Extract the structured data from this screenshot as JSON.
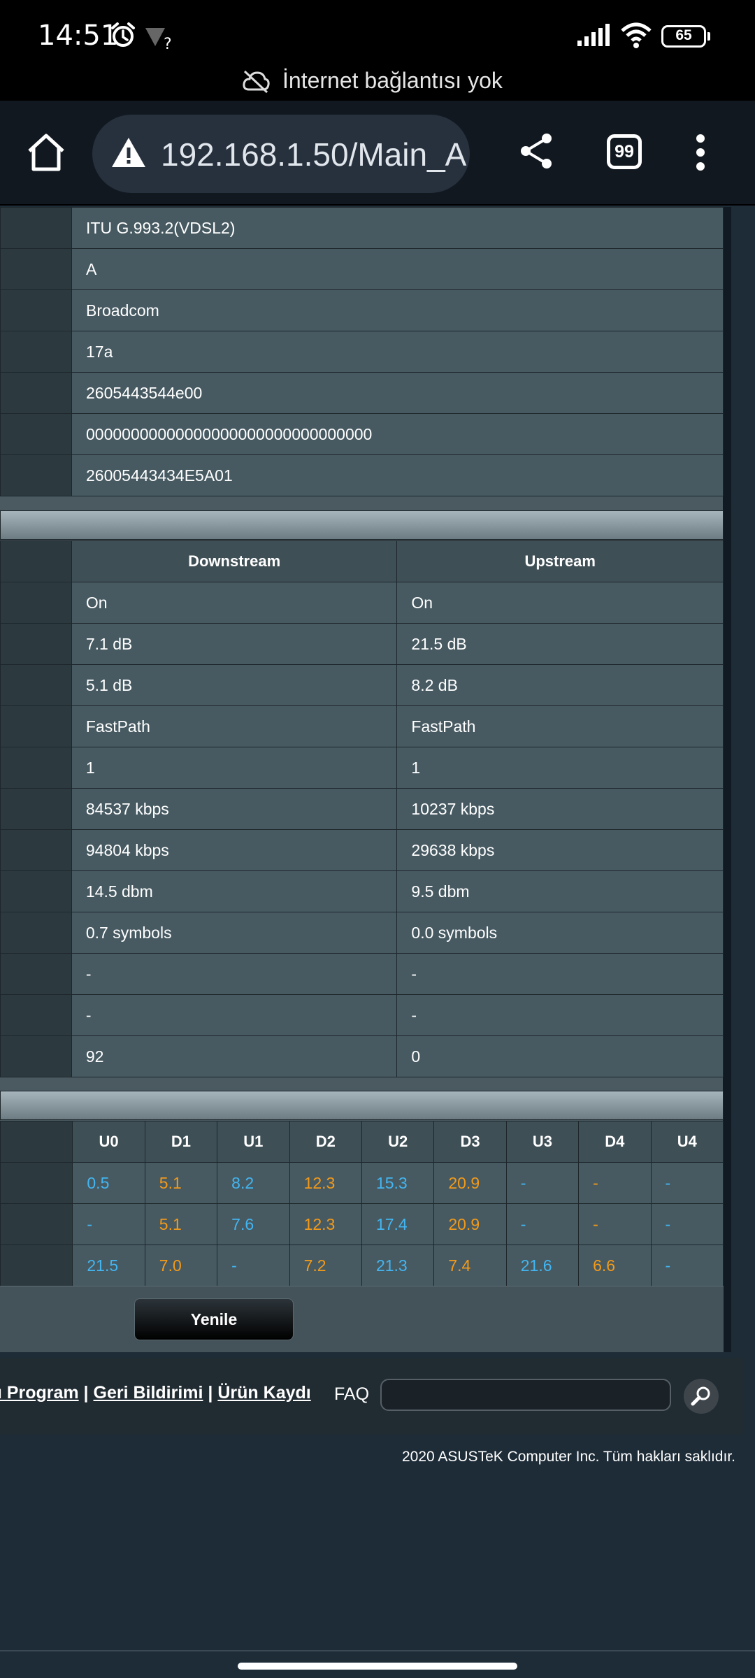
{
  "status_bar": {
    "time": "14:51",
    "battery": "65"
  },
  "offline_banner": {
    "text": "İnternet bağlantısı yok"
  },
  "browser": {
    "url": "192.168.1.50/Main_A",
    "tab_count": "99"
  },
  "info_rows": [
    "ITU G.993.2(VDSL2)",
    "A",
    "Broadcom",
    "17a",
    "2605443544e00",
    "00000000000000000000000000000000",
    "26005443434E5A01"
  ],
  "stats": {
    "headers": [
      "Downstream",
      "Upstream"
    ],
    "rows": [
      [
        "On",
        "On"
      ],
      [
        "7.1 dB",
        "21.5 dB"
      ],
      [
        "5.1 dB",
        "8.2 dB"
      ],
      [
        "FastPath",
        "FastPath"
      ],
      [
        "1",
        "1"
      ],
      [
        "84537 kbps",
        "10237 kbps"
      ],
      [
        "94804 kbps",
        "29638 kbps"
      ],
      [
        "14.5 dbm",
        "9.5 dbm"
      ],
      [
        "0.7 symbols",
        "0.0 symbols"
      ],
      [
        "-",
        "-"
      ],
      [
        "-",
        "-"
      ],
      [
        "92",
        "0"
      ]
    ]
  },
  "band_table": {
    "headers": [
      "U0",
      "D1",
      "U1",
      "D2",
      "U2",
      "D3",
      "U3",
      "D4",
      "U4"
    ],
    "rows": [
      [
        "0.5",
        "5.1",
        "8.2",
        "12.3",
        "15.3",
        "20.9",
        "-",
        "-",
        "-"
      ],
      [
        "-",
        "5.1",
        "7.6",
        "12.3",
        "17.4",
        "20.9",
        "-",
        "-",
        "-"
      ],
      [
        "21.5",
        "7.0",
        "-",
        "7.2",
        "21.3",
        "7.4",
        "21.6",
        "6.6",
        "-"
      ]
    ],
    "colors": {
      "upstream": "#43b5f0",
      "downstream": "#f29a1a"
    }
  },
  "refresh_button": "Yenile",
  "footer": {
    "link1": "cı Program",
    "sep1": " | ",
    "link2": "Geri Bildirimi",
    "sep2": " | ",
    "link3": "Ürün Kaydı",
    "faq": "FAQ",
    "copyright": "2020 ASUSTeK Computer Inc. Tüm hakları saklıdır."
  }
}
